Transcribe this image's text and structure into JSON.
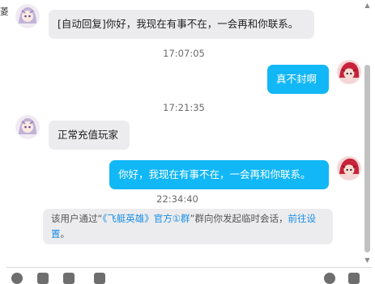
{
  "corner_text": "菱",
  "messages": {
    "msg1": {
      "text": "[自动回复]你好，我现在有事不在，一会再和你联系。"
    },
    "time1": "17:07:05",
    "msg2": {
      "text": "真不封啊"
    },
    "time2": "17:21:35",
    "msg3": {
      "text": "正常充值玩家"
    },
    "msg4": {
      "text": "你好，我现在有事不在，一会再和你联系。"
    },
    "time3": "22:34:40"
  },
  "notice": {
    "before": "该用户通过“",
    "group_link": "《飞艇英雄》官方①群",
    "middle": "”群向你发起临时会话，",
    "settings_link": "前往设置",
    "after": "。"
  },
  "colors": {
    "incoming_bubble": "#ececee",
    "outgoing_bubble": "#12b7f5",
    "link": "#1a8ee6"
  }
}
